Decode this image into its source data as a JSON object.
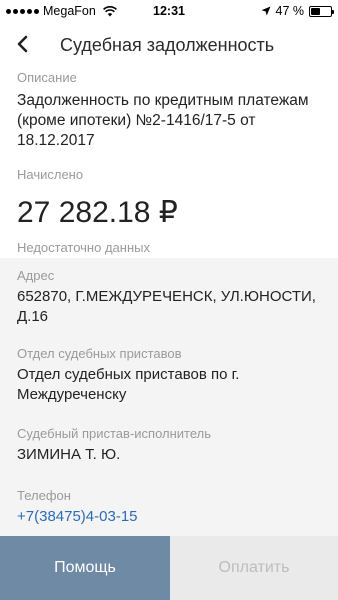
{
  "status_bar": {
    "carrier": "MegaFon",
    "time": "12:31",
    "battery_text": "47 %",
    "battery_level": 0.47
  },
  "header": {
    "title": "Судебная задолженность"
  },
  "description": {
    "label": "Описание",
    "value": "Задолженность по кредитным платежам (кроме ипотеки) №2-1416/17-5 от 18.12.2017"
  },
  "accrued": {
    "label": "Начислено",
    "amount": "27 282.18 ₽",
    "note": "Недостаточно данных"
  },
  "details": {
    "address_label": "Адрес",
    "address_value": "652870, Г.МЕЖДУРЕЧЕНСК, УЛ.ЮНОСТИ, Д.16",
    "department_label": "Отдел судебных приставов",
    "department_value": "Отдел судебных приставов по г. Междуреченску",
    "bailiff_label": "Судебный пристав-исполнитель",
    "bailiff_value": "ЗИМИНА Т. Ю.",
    "phone_label": "Телефон",
    "phone_value": "+7(38475)4-03-15"
  },
  "buttons": {
    "help": "Помощь",
    "pay": "Оплатить"
  },
  "colors": {
    "help_button": "#6e8aa5",
    "link": "#2b6cb8",
    "gray_section": "#f4f4f4"
  }
}
